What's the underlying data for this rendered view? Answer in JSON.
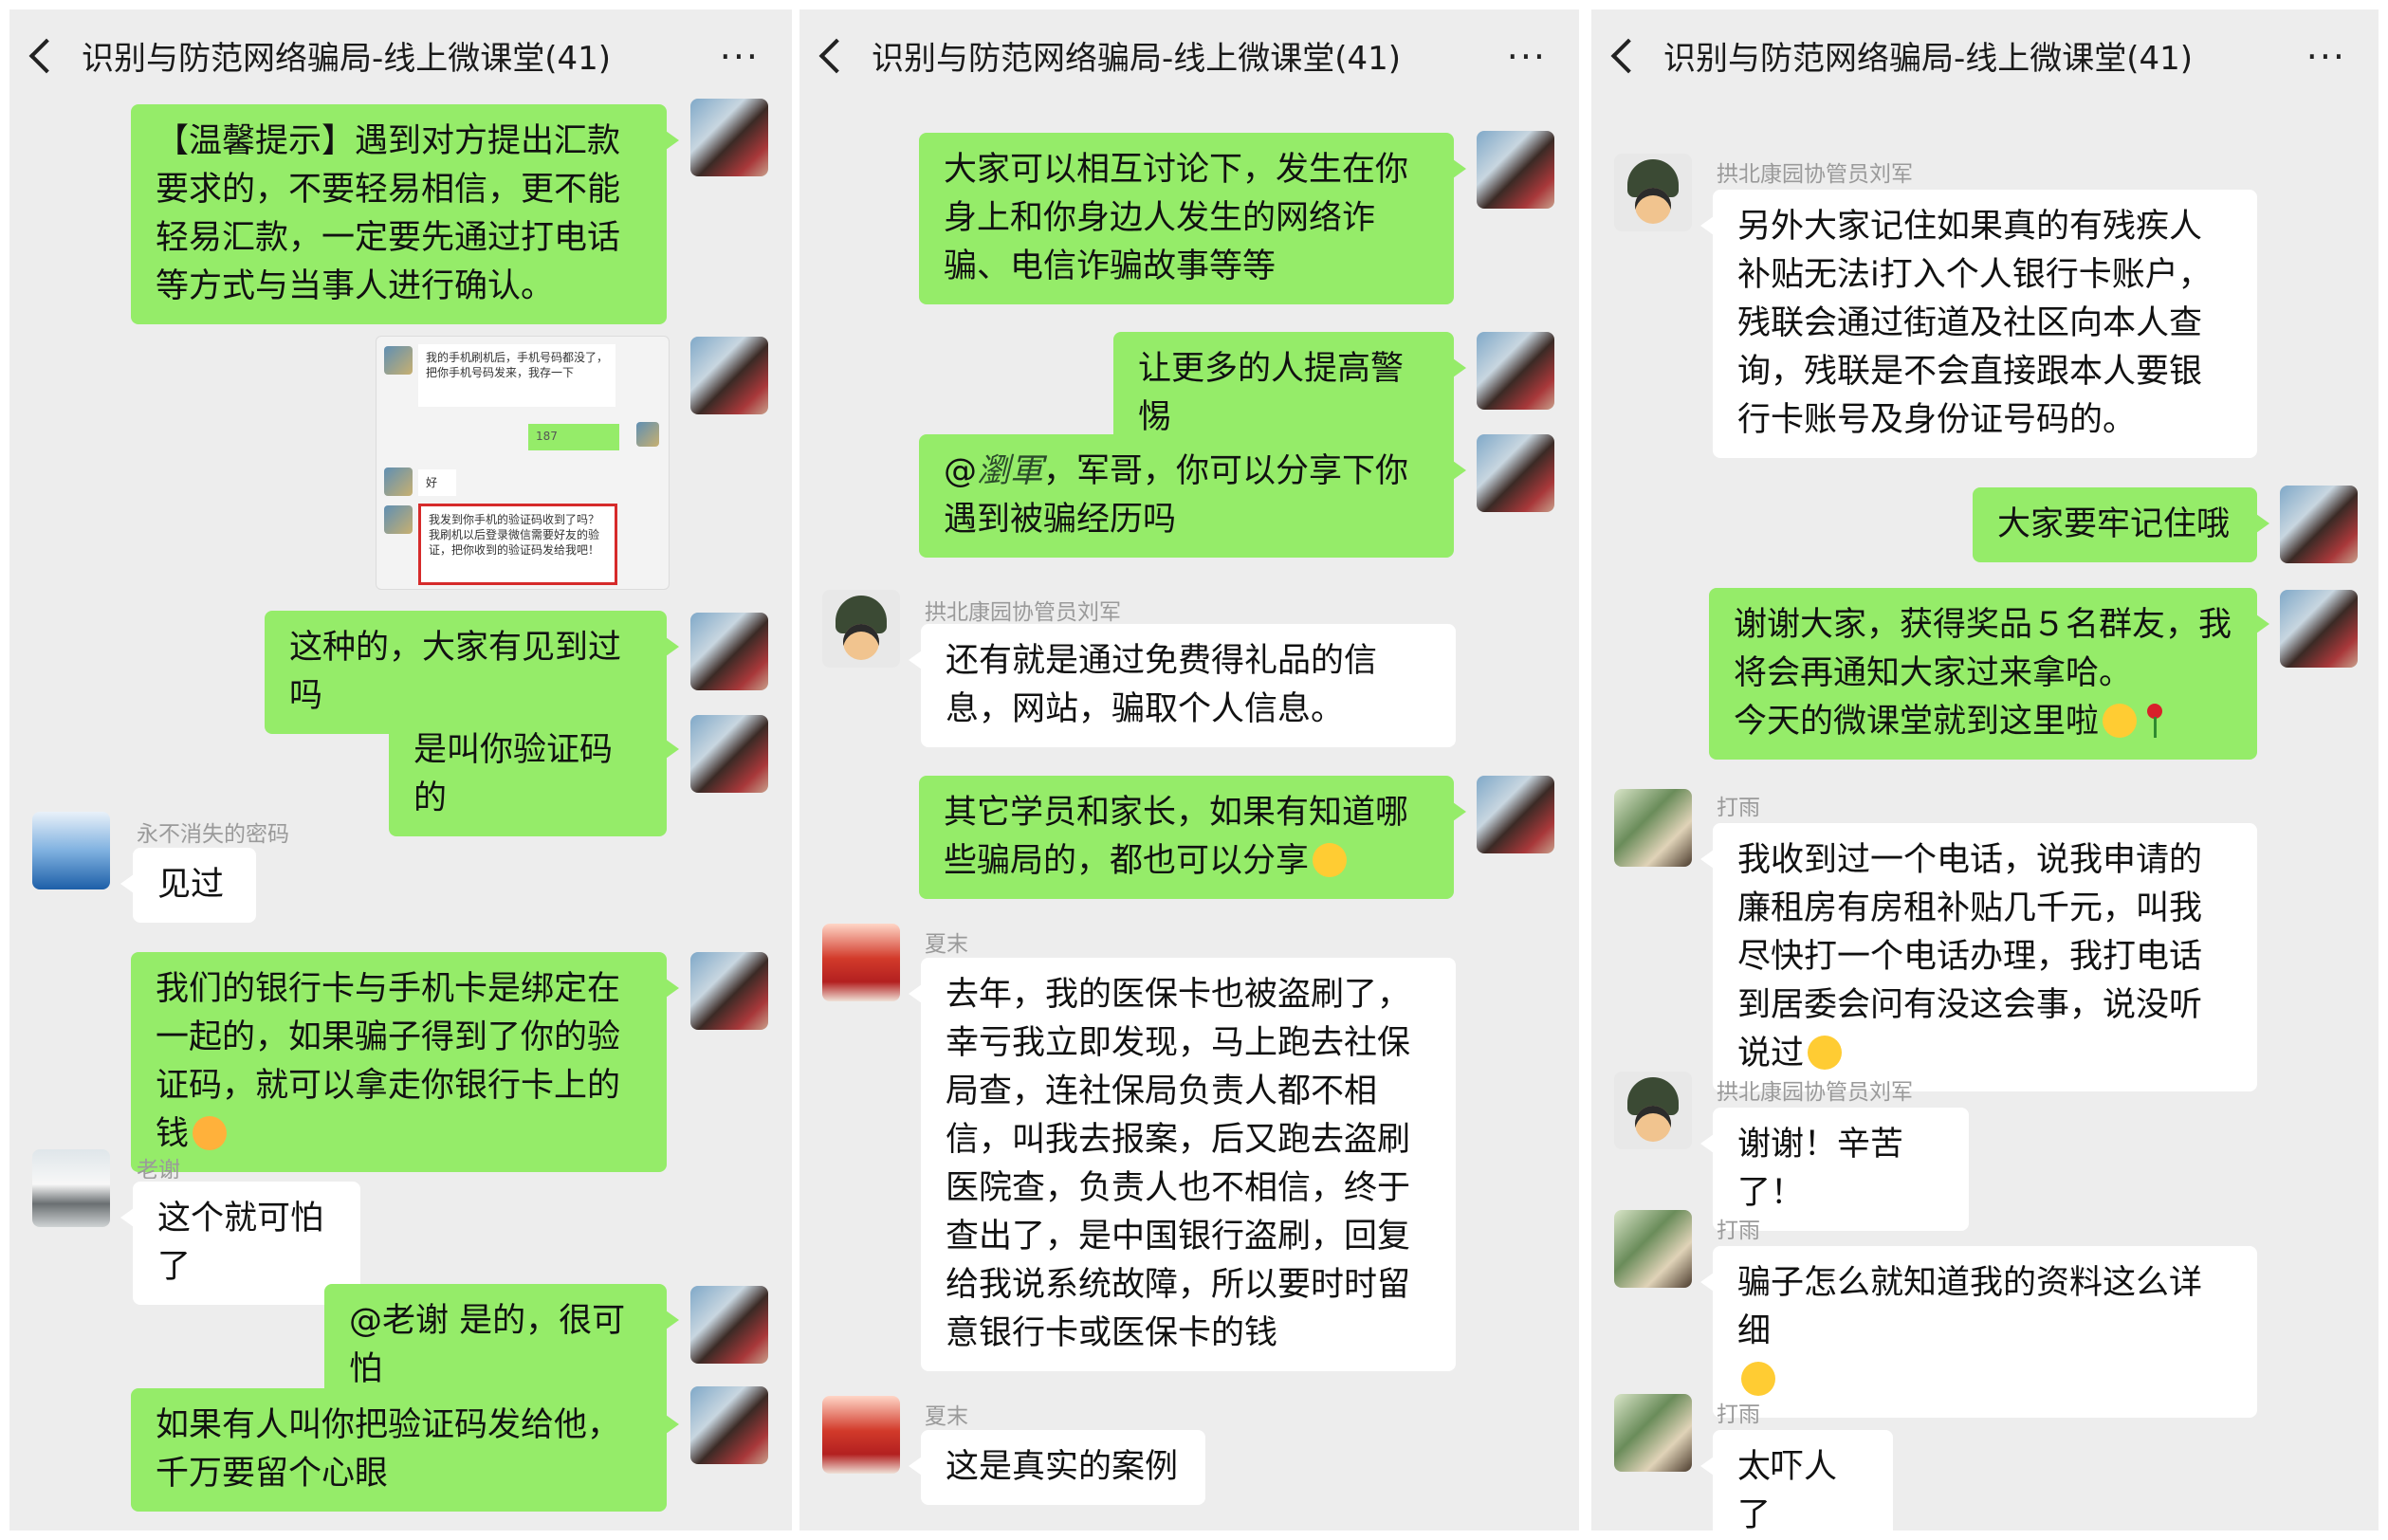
{
  "header": {
    "title": "识别与防范网络骗局-线上微课堂(41)",
    "more": "···"
  },
  "panel1": {
    "m1": "【温馨提示】遇到对方提出汇款要求的，不要轻易相信，更不能轻易汇款，一定要先通过打电话等方式与当事人进行确认。",
    "shot": {
      "line1": "我的手机刷机后，手机号码都没了，把你手机号码发来，我存一下",
      "line2": "187",
      "line3": "好",
      "line4": "我发到你手机的验证码收到了吗？我刷机以后登录微信需要好友的验证，把你收到的验证码发给我吧！"
    },
    "m2": "这种的，大家有见到过吗",
    "m3": "是叫你验证码的",
    "n4": "永不消失的密码",
    "m4": "见过",
    "m5": "我们的银行卡与手机卡是绑定在一起的，如果骗子得到了你的验证码，就可以拿走你银行卡上的钱",
    "n6": "老谢",
    "m6": "这个就可怕了",
    "m7": "@老谢 是的，很可怕",
    "m8": "如果有人叫你把验证码发给他，千万要留个心眼"
  },
  "panel2": {
    "m1": "大家可以相互讨论下，发生在你身上和你身边人发生的网络诈骗、电信诈骗故事等等",
    "m2": "让更多的人提高警惕",
    "m3a": "@",
    "m3b": "瀏軍",
    "m3c": "，军哥，你可以分享下你遇到被骗经历吗",
    "n4": "拱北康园协管员刘军",
    "m4": "还有就是通过免费得礼品的信息，网站，骗取个人信息。",
    "m5": "其它学员和家长，如果有知道哪些骗局的，都也可以分享",
    "n6": "夏末",
    "m6": "去年，我的医保卡也被盗刷了，幸亏我立即发现，马上跑去社保局查，连社保局负责人都不相信，叫我去报案，后又跑去盗刷医院查，负责人也不相信，终于查出了，是中国银行盗刷，回复给我说系统故障，所以要时时留意银行卡或医保卡的钱",
    "n7": "夏末",
    "m7": "这是真实的案例"
  },
  "panel3": {
    "n1": "拱北康园协管员刘军",
    "m1": "另外大家记住如果真的有残疾人补贴无法i打入个人银行卡账户，残联会通过街道及社区向本人查询，残联是不会直接跟本人要银行卡账号及身份证号码的。",
    "m2": "大家要牢记住哦",
    "m3a": "谢谢大家，获得奖品５名群友，我将会再通知大家过来拿哈。",
    "m3b": "今天的微课堂就到这里啦",
    "n4": "打雨",
    "m4": "我收到过一个电话，说我申请的廉租房有房租补贴几千元，叫我尽快打一个电话办理，我打电话到居委会问有没这会事，说没听说过",
    "n5": "拱北康园协管员刘军",
    "m5": "谢谢！辛苦了！",
    "n6": "打雨",
    "m6": "骗子怎么就知道我的资料这么详细",
    "n7": "打雨",
    "m7": "太吓人了"
  },
  "icons": [
    "back-icon",
    "more-icon",
    "avatar-me",
    "avatar-soldier",
    "avatar-sea",
    "avatar-dog",
    "avatar-rose",
    "avatar-rain",
    "emoji-grin",
    "emoji-angry",
    "emoji-smile",
    "rose-icon",
    "emoji-smirk"
  ],
  "colors": {
    "bg": "#ededed",
    "outgoing": "#95ec69",
    "incoming": "#ffffff",
    "name": "#9a9a9a",
    "highlight": "#d62b2b"
  }
}
